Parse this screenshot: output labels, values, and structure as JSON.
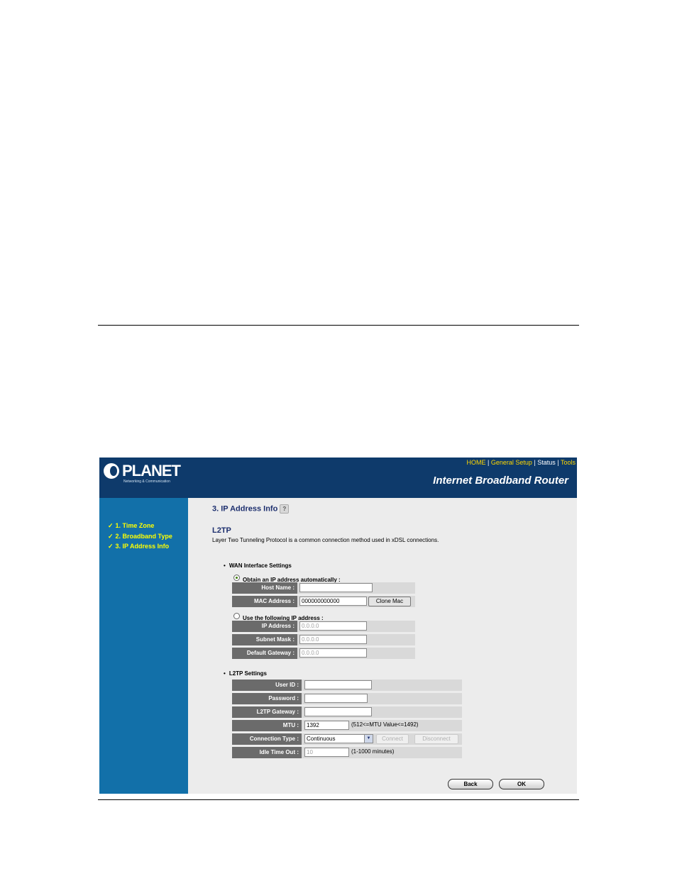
{
  "header": {
    "logo_text": "PLANET",
    "logo_tagline": "Networking & Communication",
    "nav": [
      "HOME",
      "General Setup",
      "Status",
      "Tools"
    ],
    "nav_separator": " | ",
    "product": "Internet Broadband Router"
  },
  "sidebar": {
    "items": [
      {
        "label": "1. Time Zone"
      },
      {
        "label": "2. Broadband Type"
      },
      {
        "label": "3. IP Address Info"
      }
    ]
  },
  "main": {
    "step_title": "3. IP Address Info",
    "mode_title": "L2TP",
    "mode_description": "Layer Two Tunneling Protocol is a common connection method used in xDSL connections.",
    "wan": {
      "heading": "WAN Interface Settings",
      "auto_option": "Obtain an IP address automatically :",
      "manual_option": "Use the following IP address :",
      "selected": "auto",
      "host_name_label": "Host Name :",
      "host_name_value": "",
      "mac_label": "MAC Address :",
      "mac_value": "000000000000",
      "clone_mac_label": "Clone Mac",
      "ip_label": "IP Address :",
      "ip_value": "0.0.0.0",
      "mask_label": "Subnet Mask :",
      "mask_value": "0.0.0.0",
      "gateway_label": "Default Gateway :",
      "gateway_value": "0.0.0.0"
    },
    "l2tp": {
      "heading": "L2TP Settings",
      "user_label": "User ID :",
      "user_value": "",
      "password_label": "Password :",
      "password_value": "",
      "gateway_label": "L2TP Gateway :",
      "gateway_value": "",
      "mtu_label": "MTU :",
      "mtu_value": "1392",
      "mtu_hint": "(512<=MTU Value<=1492)",
      "conn_type_label": "Connection Type :",
      "conn_type_value": "Continuous",
      "connect_label": "Connect",
      "disconnect_label": "Disconnect",
      "idle_label": "Idle Time Out :",
      "idle_value": "10",
      "idle_hint": "(1-1000 minutes)"
    },
    "back_label": "Back",
    "ok_label": "OK"
  },
  "colors": {
    "header_bg": "#0e3a6b",
    "sidebar_bg": "#1270a9",
    "sidebar_text": "#ffff00",
    "nav_link": "#ffd800",
    "content_bg": "#ececec",
    "label_bg": "#6b6b6b"
  },
  "icons": {
    "sidebar_check": "checkmark-icon",
    "help": "help-icon",
    "select_arrow": "chevron-down-icon"
  }
}
